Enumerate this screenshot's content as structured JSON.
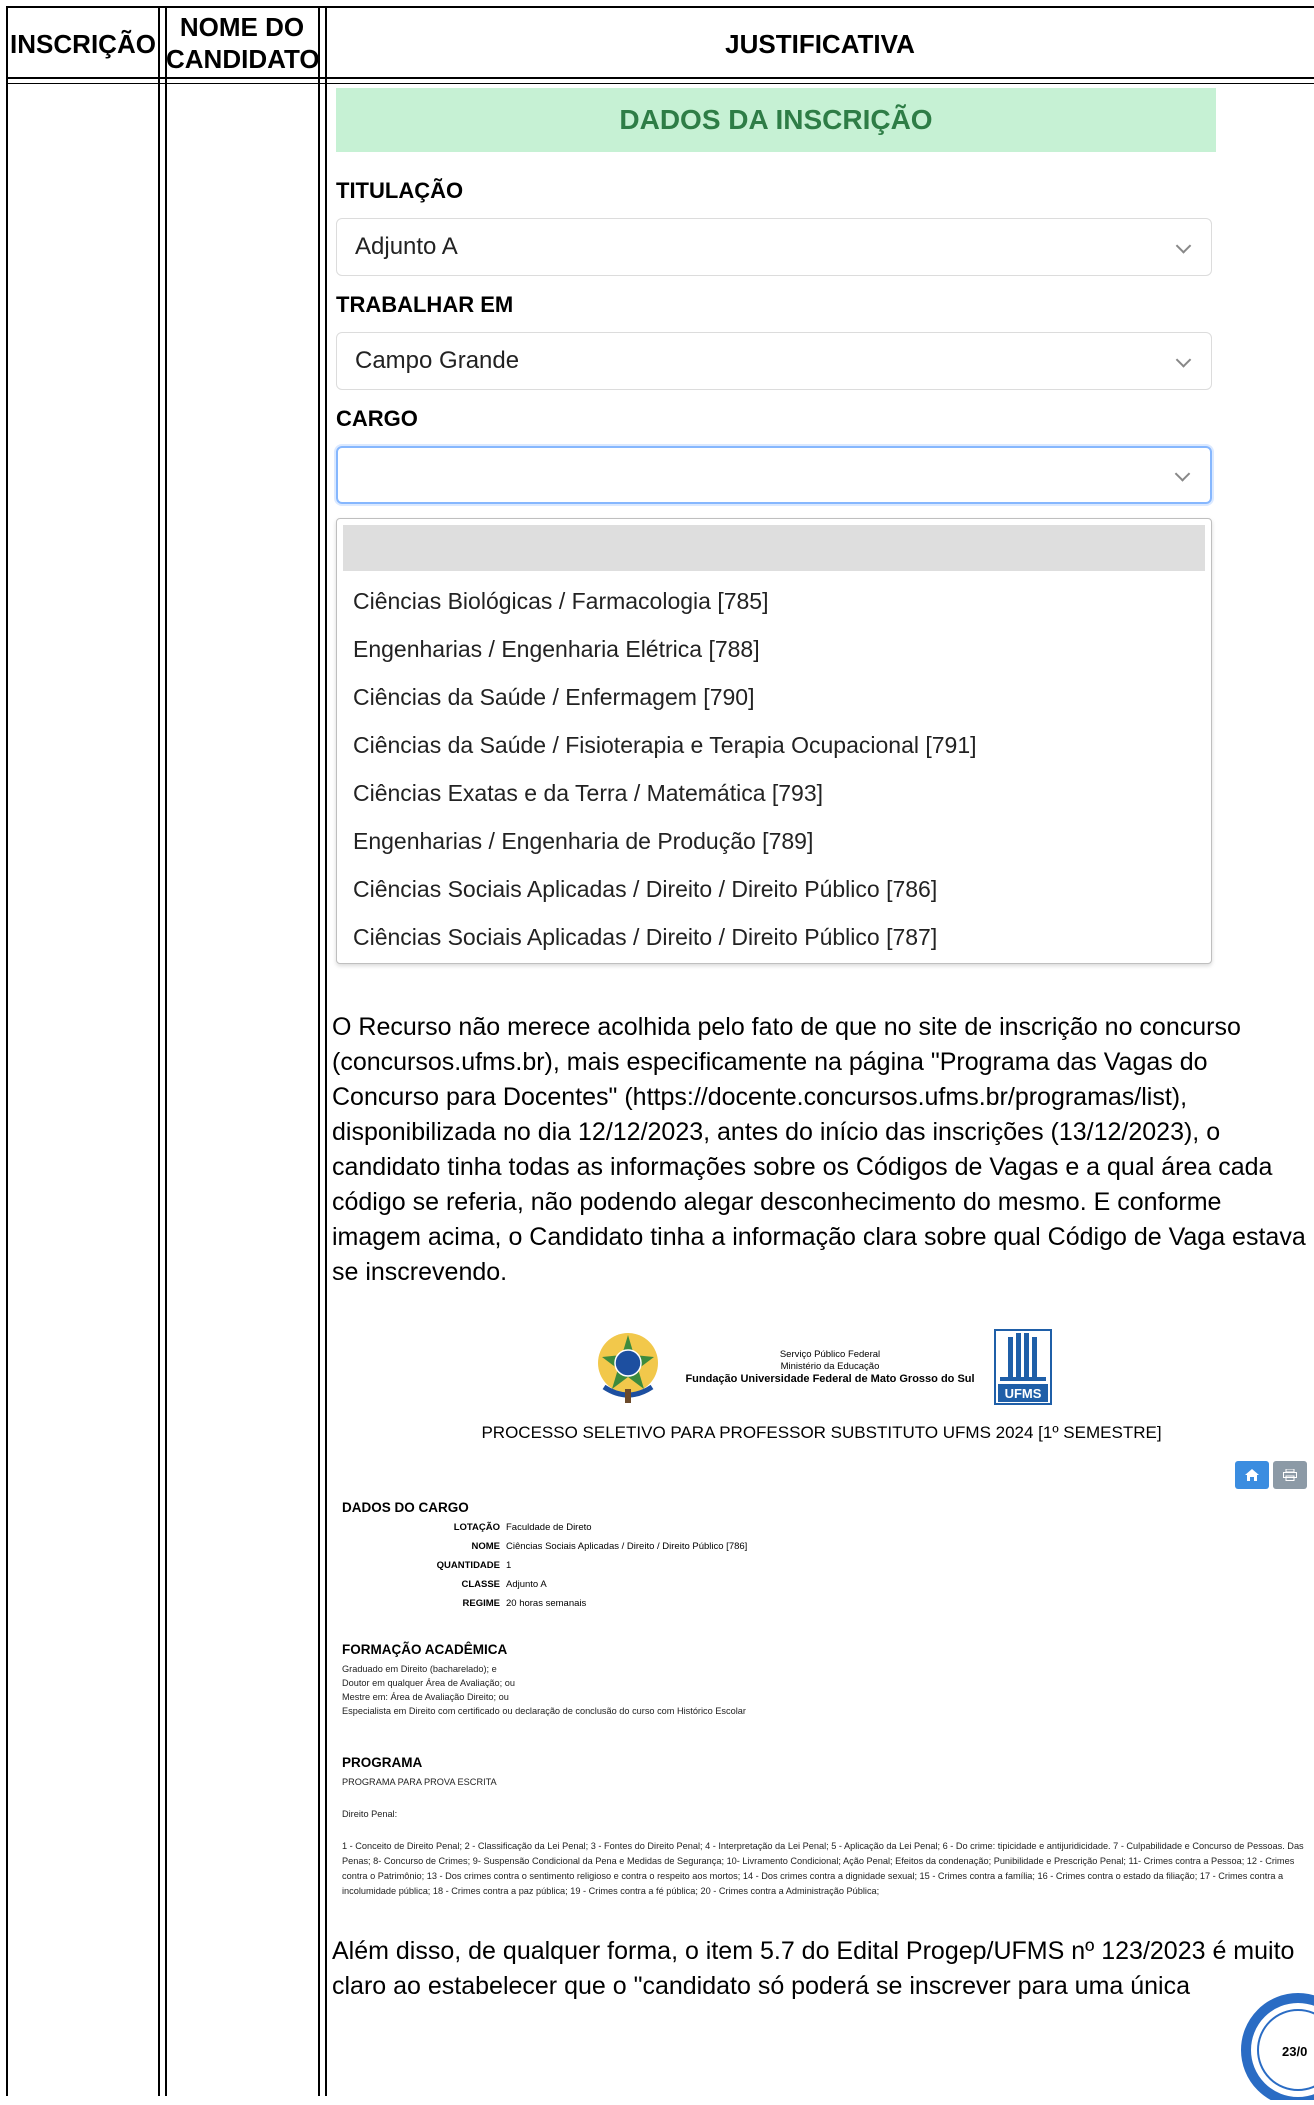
{
  "table": {
    "col_inscricao": "INSCRIÇÃO",
    "col_nome_line1": "NOME DO",
    "col_nome_line2": "CANDIDATO",
    "col_justificativa": "JUSTIFICATIVA"
  },
  "form": {
    "banner": "DADOS DA INSCRIÇÃO",
    "titulacao_label": "TITULAÇÃO",
    "titulacao_value": "Adjunto A",
    "trabalhar_label": "TRABALHAR EM",
    "trabalhar_value": "Campo Grande",
    "cargo_label": "CARGO",
    "cargo_value": "",
    "options": [
      "Ciências Biológicas / Farmacologia [785]",
      "Engenharias / Engenharia Elétrica [788]",
      "Ciências da Saúde / Enfermagem [790]",
      "Ciências da Saúde / Fisioterapia e Terapia Ocupacional [791]",
      "Ciências Exatas e da Terra / Matemática [793]",
      "Engenharias / Engenharia de Produção [789]",
      "Ciências Sociais Aplicadas / Direito / Direito Público [786]",
      "Ciências Sociais Aplicadas / Direito / Direito Público [787]"
    ]
  },
  "justification": "O Recurso não merece acolhida pelo fato de que no site de inscrição no concurso (concursos.ufms.br), mais especificamente na página \"Programa das Vagas do Concurso para Docentes\" (https://docente.concursos.ufms.br/programas/list), disponibilizada no dia 12/12/2023, antes do início das inscrições (13/12/2023), o candidato tinha todas as informações sobre os Códigos de Vagas e a qual área cada código se referia, não podendo alegar desconhecimento do mesmo. E conforme imagem acima, o Candidato tinha a informação clara sobre qual Código de Vaga estava se inscrevendo.",
  "program": {
    "gov_line1": "Serviço Público Federal",
    "gov_line2": "Ministério da Educação",
    "gov_line3": "Fundação Universidade Federal de Mato Grosso do Sul",
    "logo_text": "UFMS",
    "title": "PROCESSO SELETIVO PARA PROFESSOR SUBSTITUTO UFMS 2024 [1º SEMESTRE]",
    "dados_cargo": "DADOS DO CARGO",
    "fields": [
      {
        "k": "LOTAÇÃO",
        "v": "Faculdade de Direto"
      },
      {
        "k": "NOME",
        "v": "Ciências Sociais Aplicadas / Direito / Direito Público [786]"
      },
      {
        "k": "QUANTIDADE",
        "v": "1"
      },
      {
        "k": "CLASSE",
        "v": "Adjunto A"
      },
      {
        "k": "REGIME",
        "v": "20 horas semanais"
      }
    ],
    "formacao_title": "FORMAÇÃO ACADÊMICA",
    "formacao": [
      "Graduado em Direito (bacharelado); e",
      "Doutor em qualquer Área de Avaliação; ou",
      "Mestre em: Área de Avaliação Direito; ou",
      "Especialista em Direito com certificado ou declaração de conclusão do curso com Histórico Escolar"
    ],
    "programa_title": "PROGRAMA",
    "programa_sub": "PROGRAMA PARA PROVA ESCRITA",
    "programa_area": "Direito Penal:",
    "programa_text": "1 - Conceito de Direito Penal; 2 - Classificação da Lei Penal; 3 - Fontes do Direito Penal; 4 - Interpretação da Lei Penal; 5 - Aplicação da Lei Penal; 6 - Do crime: tipicidade e antijuridicidade. 7 - Culpabilidade e Concurso de Pessoas. Das Penas; 8- Concurso de Crimes; 9- Suspensão Condicional da Pena e Medidas de Segurança; 10- Livramento Condicional; Ação Penal; Efeitos da condenação; Punibilidade e Prescrição Penal; 11- Crimes contra a Pessoa; 12 - Crimes contra o Patrimônio; 13 - Dos crimes contra o sentimento religioso e contra o respeito aos mortos; 14 - Dos crimes contra a dignidade sexual; 15 - Crimes contra a família; 16 - Crimes contra o estado da filiação; 17 - Crimes contra a incolumidade pública; 18 - Crimes contra a paz pública; 19 - Crimes contra a fé pública; 20 - Crimes contra a Administração Pública;"
  },
  "tail": "Além disso, de qualquer forma, o item 5.7 do Edital Progep/UFMS nº 123/2023 é muito claro ao estabelecer que o \"candidato só poderá se inscrever para uma única",
  "seal_text": "23/0",
  "colors": {
    "banner_bg": "#c6f1d4",
    "banner_text": "#2e7d46",
    "focus": "#86b7fe",
    "home_btn": "#3b8de0",
    "print_btn": "#8c9aa6"
  }
}
